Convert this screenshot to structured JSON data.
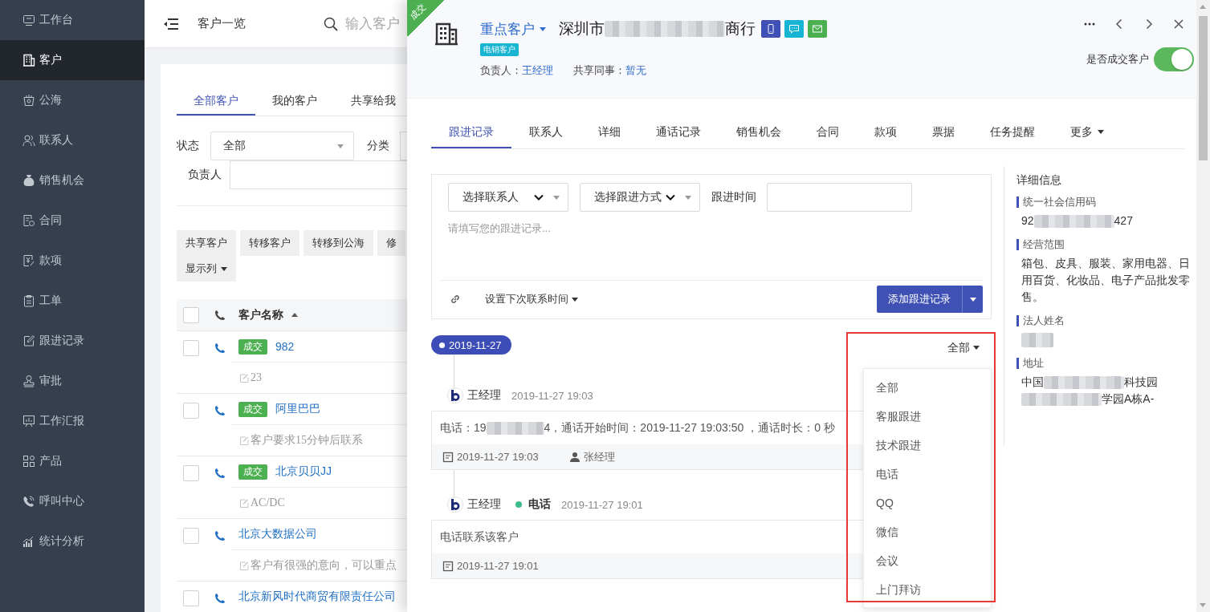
{
  "sidebar": {
    "items": [
      {
        "label": "工作台",
        "selected": false
      },
      {
        "label": "客户",
        "selected": true
      },
      {
        "label": "公海",
        "selected": false
      },
      {
        "label": "联系人",
        "selected": false
      },
      {
        "label": "销售机会",
        "selected": false
      },
      {
        "label": "合同",
        "selected": false
      },
      {
        "label": "款项",
        "selected": false
      },
      {
        "label": "工单",
        "selected": false
      },
      {
        "label": "跟进记录",
        "selected": false
      },
      {
        "label": "审批",
        "selected": false
      },
      {
        "label": "工作汇报",
        "selected": false
      },
      {
        "label": "产品",
        "selected": false
      },
      {
        "label": "呼叫中心",
        "selected": false
      },
      {
        "label": "统计分析",
        "selected": false
      }
    ]
  },
  "page_header": {
    "title": "客户一览",
    "search": {
      "placeholder": "输入客户"
    }
  },
  "customer_tabs": [
    {
      "label": "全部客户",
      "selected": true
    },
    {
      "label": "我的客户",
      "selected": false
    },
    {
      "label": "共享给我",
      "selected": false
    }
  ],
  "filters": {
    "status": {
      "label": "状态",
      "value": "全部"
    },
    "category": {
      "label": "分类"
    },
    "owner": {
      "label": "负责人"
    }
  },
  "actions": [
    {
      "label": "共享客户",
      "kind": "button"
    },
    {
      "label": "转移客户",
      "kind": "button"
    },
    {
      "label": "转移到公海",
      "kind": "button"
    },
    {
      "label": "修",
      "kind": "button"
    },
    {
      "label": "显示列",
      "kind": "dropdown"
    }
  ],
  "table": {
    "header_checked": false,
    "columns": [
      {
        "label": "客户名称"
      }
    ],
    "rows": [
      {
        "checked": false,
        "tag": "成交",
        "name": "982",
        "note": "23"
      },
      {
        "checked": false,
        "tag": "成交",
        "name": "阿里巴巴",
        "note": "客户要求15分钟后联系"
      },
      {
        "checked": false,
        "tag": "成交",
        "name": "北京贝贝JJ",
        "note": "AC/DC"
      },
      {
        "checked": false,
        "name": "北京大数据公司",
        "note": "客户有很强的意向，可以重点"
      },
      {
        "checked": false,
        "name": "北京新风时代商贸有限责任公司"
      }
    ]
  },
  "drawer": {
    "ribbon": "成交",
    "customer_type": "重点客户",
    "name_parts": [
      "深圳市",
      "商行"
    ],
    "tag": "电销客户",
    "owner": {
      "label": "负责人：",
      "value": "王经理"
    },
    "shared": {
      "label": "共享同事：",
      "value": "暂无"
    },
    "deal_toggle": {
      "label": "是否成交客户",
      "on": true
    },
    "tabs": [
      {
        "label": "跟进记录",
        "selected": true,
        "kind": "tab"
      },
      {
        "label": "联系人",
        "selected": false,
        "kind": "tab"
      },
      {
        "label": "详细",
        "selected": false,
        "kind": "tab"
      },
      {
        "label": "通话记录",
        "selected": false,
        "kind": "tab"
      },
      {
        "label": "销售机会",
        "selected": false,
        "kind": "tab"
      },
      {
        "label": "合同",
        "selected": false,
        "kind": "tab"
      },
      {
        "label": "款项",
        "selected": false,
        "kind": "tab"
      },
      {
        "label": "票据",
        "selected": false,
        "kind": "tab"
      },
      {
        "label": "任务提醒",
        "selected": false,
        "kind": "tab"
      },
      {
        "label": "更多",
        "selected": false,
        "kind": "dropdown"
      }
    ],
    "form": {
      "contact_select": "选择联系人",
      "method_select": "选择跟进方式",
      "time_label": "跟进时间",
      "note_placeholder": "请填写您的跟进记录...",
      "next_contact": "设置下次联系时间",
      "submit": "添加跟进记录"
    },
    "timeline": {
      "date": "2019-11-27",
      "filter": "全部",
      "filter_options": [
        "全部",
        "客服跟进",
        "技术跟进",
        "电话",
        "QQ",
        "微信",
        "会议",
        "上门拜访"
      ],
      "entries": [
        {
          "author": "王经理",
          "time": "2019-11-27 19:03",
          "text_parts": [
            "电话：19",
            "4，通话开始时间：2019-11-27 19:03:50 ，通话时长：0 秒"
          ],
          "footer_time": "2019-11-27 19:03",
          "footer_user": "张经理"
        },
        {
          "author": "王经理",
          "method": "电话",
          "time": "2019-11-27 19:01",
          "text_parts": [
            "电话联系该客户"
          ],
          "footer_time": "2019-11-27 19:01"
        }
      ]
    },
    "details": {
      "title": "详细信息",
      "fields": [
        {
          "label": "统一社会信用码",
          "kind": "text",
          "value_parts": [
            "92",
            "427"
          ]
        },
        {
          "label": "经营范围",
          "kind": "text",
          "value_parts": [
            "箱包、皮具、服装、家用电器、日用百货、化妆品、电子产品批发零售。"
          ]
        },
        {
          "label": "法人姓名",
          "kind": "blurred"
        },
        {
          "label": "地址",
          "kind": "text",
          "value_parts": [
            "中国",
            "科技园",
            "学园A栋A-"
          ]
        }
      ]
    }
  }
}
